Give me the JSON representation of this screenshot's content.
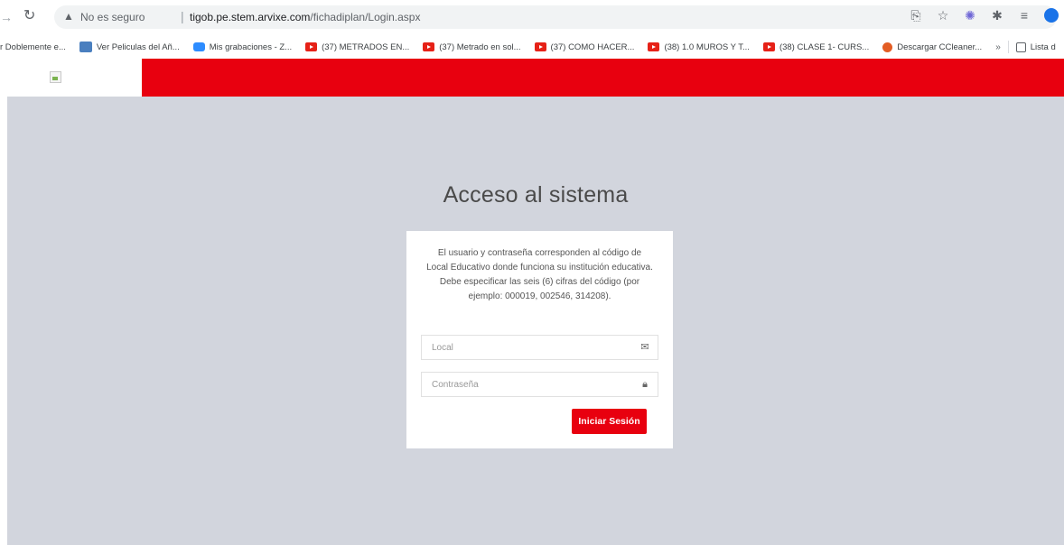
{
  "browser": {
    "nav_forward_icon": "forward-arrow-icon",
    "reload_icon": "reload-icon",
    "security_icon": "warning-triangle-icon",
    "security_label": "No es seguro",
    "separator": "|",
    "url_host": "tigob.pe.stem.arvixe.com",
    "url_path": "/fichadiplan/Login.aspx",
    "toolbar_icons": [
      "share-icon",
      "star-icon",
      "extension-icon",
      "puzzle-icon",
      "reading-list-icon",
      "profile-icon"
    ]
  },
  "bookmarks": {
    "items": [
      {
        "label": "r Doblemente e...",
        "icon": "none"
      },
      {
        "label": "Ver Peliculas del Añ...",
        "icon": "calendar-icon"
      },
      {
        "label": "Mis grabaciones - Z...",
        "icon": "zoom-icon"
      },
      {
        "label": "(37) METRADOS EN...",
        "icon": "youtube-icon"
      },
      {
        "label": "(37) Metrado en sol...",
        "icon": "youtube-icon"
      },
      {
        "label": "(37) COMO HACER...",
        "icon": "youtube-icon"
      },
      {
        "label": "(38) 1.0 MUROS Y T...",
        "icon": "youtube-icon"
      },
      {
        "label": "(38) CLASE 1- CURS...",
        "icon": "youtube-icon"
      },
      {
        "label": "Descargar CCleaner...",
        "icon": "ccleaner-icon"
      }
    ],
    "more": "»",
    "reading_list": "Lista d"
  },
  "header": {
    "logo_icon": "broken-image-icon",
    "accent_color": "#e8000f"
  },
  "login": {
    "title": "Acceso al sistema",
    "info": "El usuario y contraseña corresponden al código de Local Educativo donde funciona su institución educativa. Debe especificar las seis (6) cifras del código (por ejemplo: 000019, 002546, 314208).",
    "local_placeholder": "Local",
    "local_value": "",
    "local_icon": "envelope-icon",
    "password_placeholder": "Contraseña",
    "password_value": "",
    "password_icon": "lock-icon",
    "submit_label": "Iniciar Sesión",
    "background_color": "#d2d5dd"
  }
}
